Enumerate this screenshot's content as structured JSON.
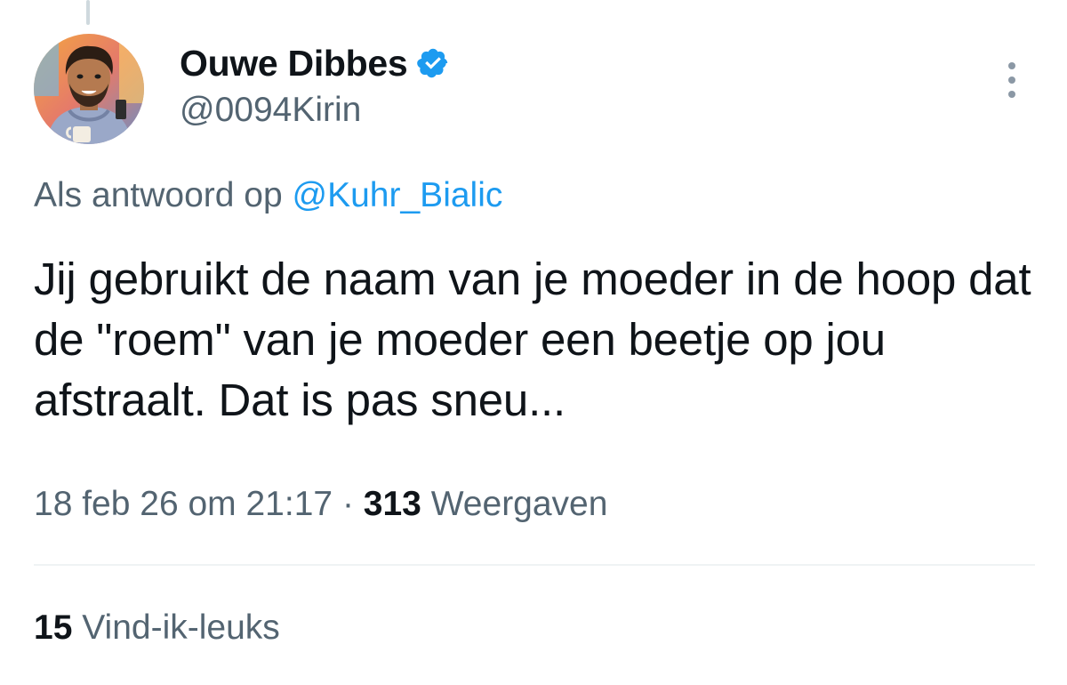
{
  "author": {
    "display_name": "Ouwe Dibbes",
    "handle": "@0094Kirin",
    "verified_icon": "verified-badge-icon",
    "avatar_icon": "profile-photo"
  },
  "reply": {
    "prefix": "Als antwoord op",
    "mention": "@Kuhr_Bialic"
  },
  "tweet": {
    "text": "Jij gebruikt de naam van je moeder in de hoop dat de \"roem\" van je moeder een beetje op jou afstraalt. Dat is pas sneu..."
  },
  "meta": {
    "timestamp": "18 feb 26 om 21:17",
    "separator": "·",
    "views_count": "313",
    "views_label": "Weergaven"
  },
  "likes": {
    "count": "15",
    "label": "Vind-ik-leuks"
  },
  "menu": {
    "icon": "more-vertical-icon"
  },
  "colors": {
    "link": "#1d9bf0",
    "text_primary": "#0f1419",
    "text_secondary": "#536471",
    "divider": "#eff3f4"
  }
}
